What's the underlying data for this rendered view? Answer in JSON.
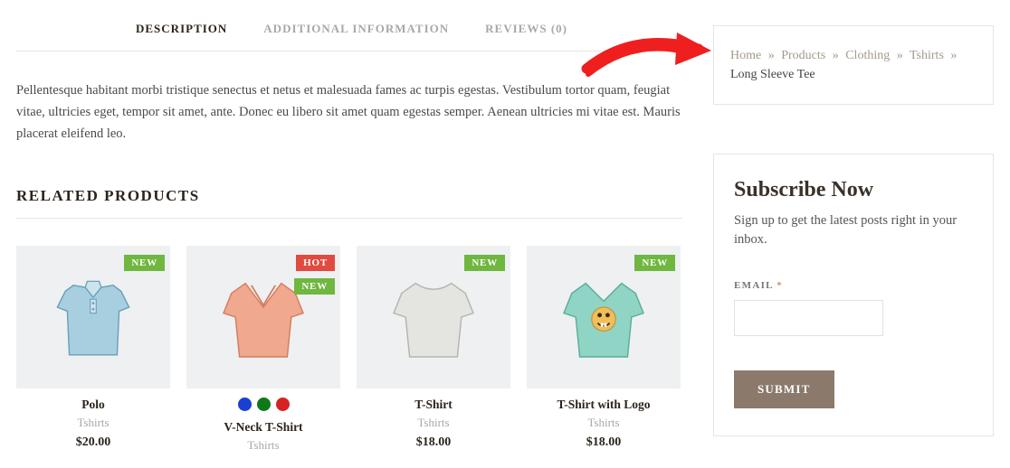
{
  "tabs": {
    "description": "DESCRIPTION",
    "additional": "ADDITIONAL INFORMATION",
    "reviews": "REVIEWS (0)"
  },
  "description_paragraph": "Pellentesque habitant morbi tristique senectus et netus et malesuada fames ac turpis egestas. Vestibulum tortor quam, feugiat vitae, ultricies eget, tempor sit amet, ante. Donec eu libero sit amet quam egestas semper. Aenean ultricies mi vitae est. Mauris placerat eleifend leo.",
  "related_heading": "RELATED PRODUCTS",
  "badges": {
    "new": "NEW",
    "hot": "HOT"
  },
  "products": {
    "p1": {
      "title": "Polo",
      "category": "Tshirts",
      "price": "$20.00"
    },
    "p2": {
      "title": "V-Neck T-Shirt",
      "category": "Tshirts",
      "swatches": [
        "#1a3fd1",
        "#0d7a1a",
        "#d62222"
      ]
    },
    "p3": {
      "title": "T-Shirt",
      "category": "Tshirts",
      "price": "$18.00"
    },
    "p4": {
      "title": "T-Shirt with Logo",
      "category": "Tshirts",
      "price": "$18.00"
    }
  },
  "breadcrumb": {
    "home": "Home",
    "products": "Products",
    "clothing": "Clothing",
    "tshirts": "Tshirts",
    "current": "Long Sleeve Tee",
    "sep": "»"
  },
  "subscribe": {
    "title": "Subscribe Now",
    "desc": "Sign up to get the latest posts right in your inbox.",
    "email_label": "EMAIL",
    "required": "*",
    "submit": "SUBMIT"
  },
  "colors": {
    "accent_green": "#6fb73f",
    "accent_red": "#e04a3f",
    "brand_brown": "#8b7a6c"
  }
}
